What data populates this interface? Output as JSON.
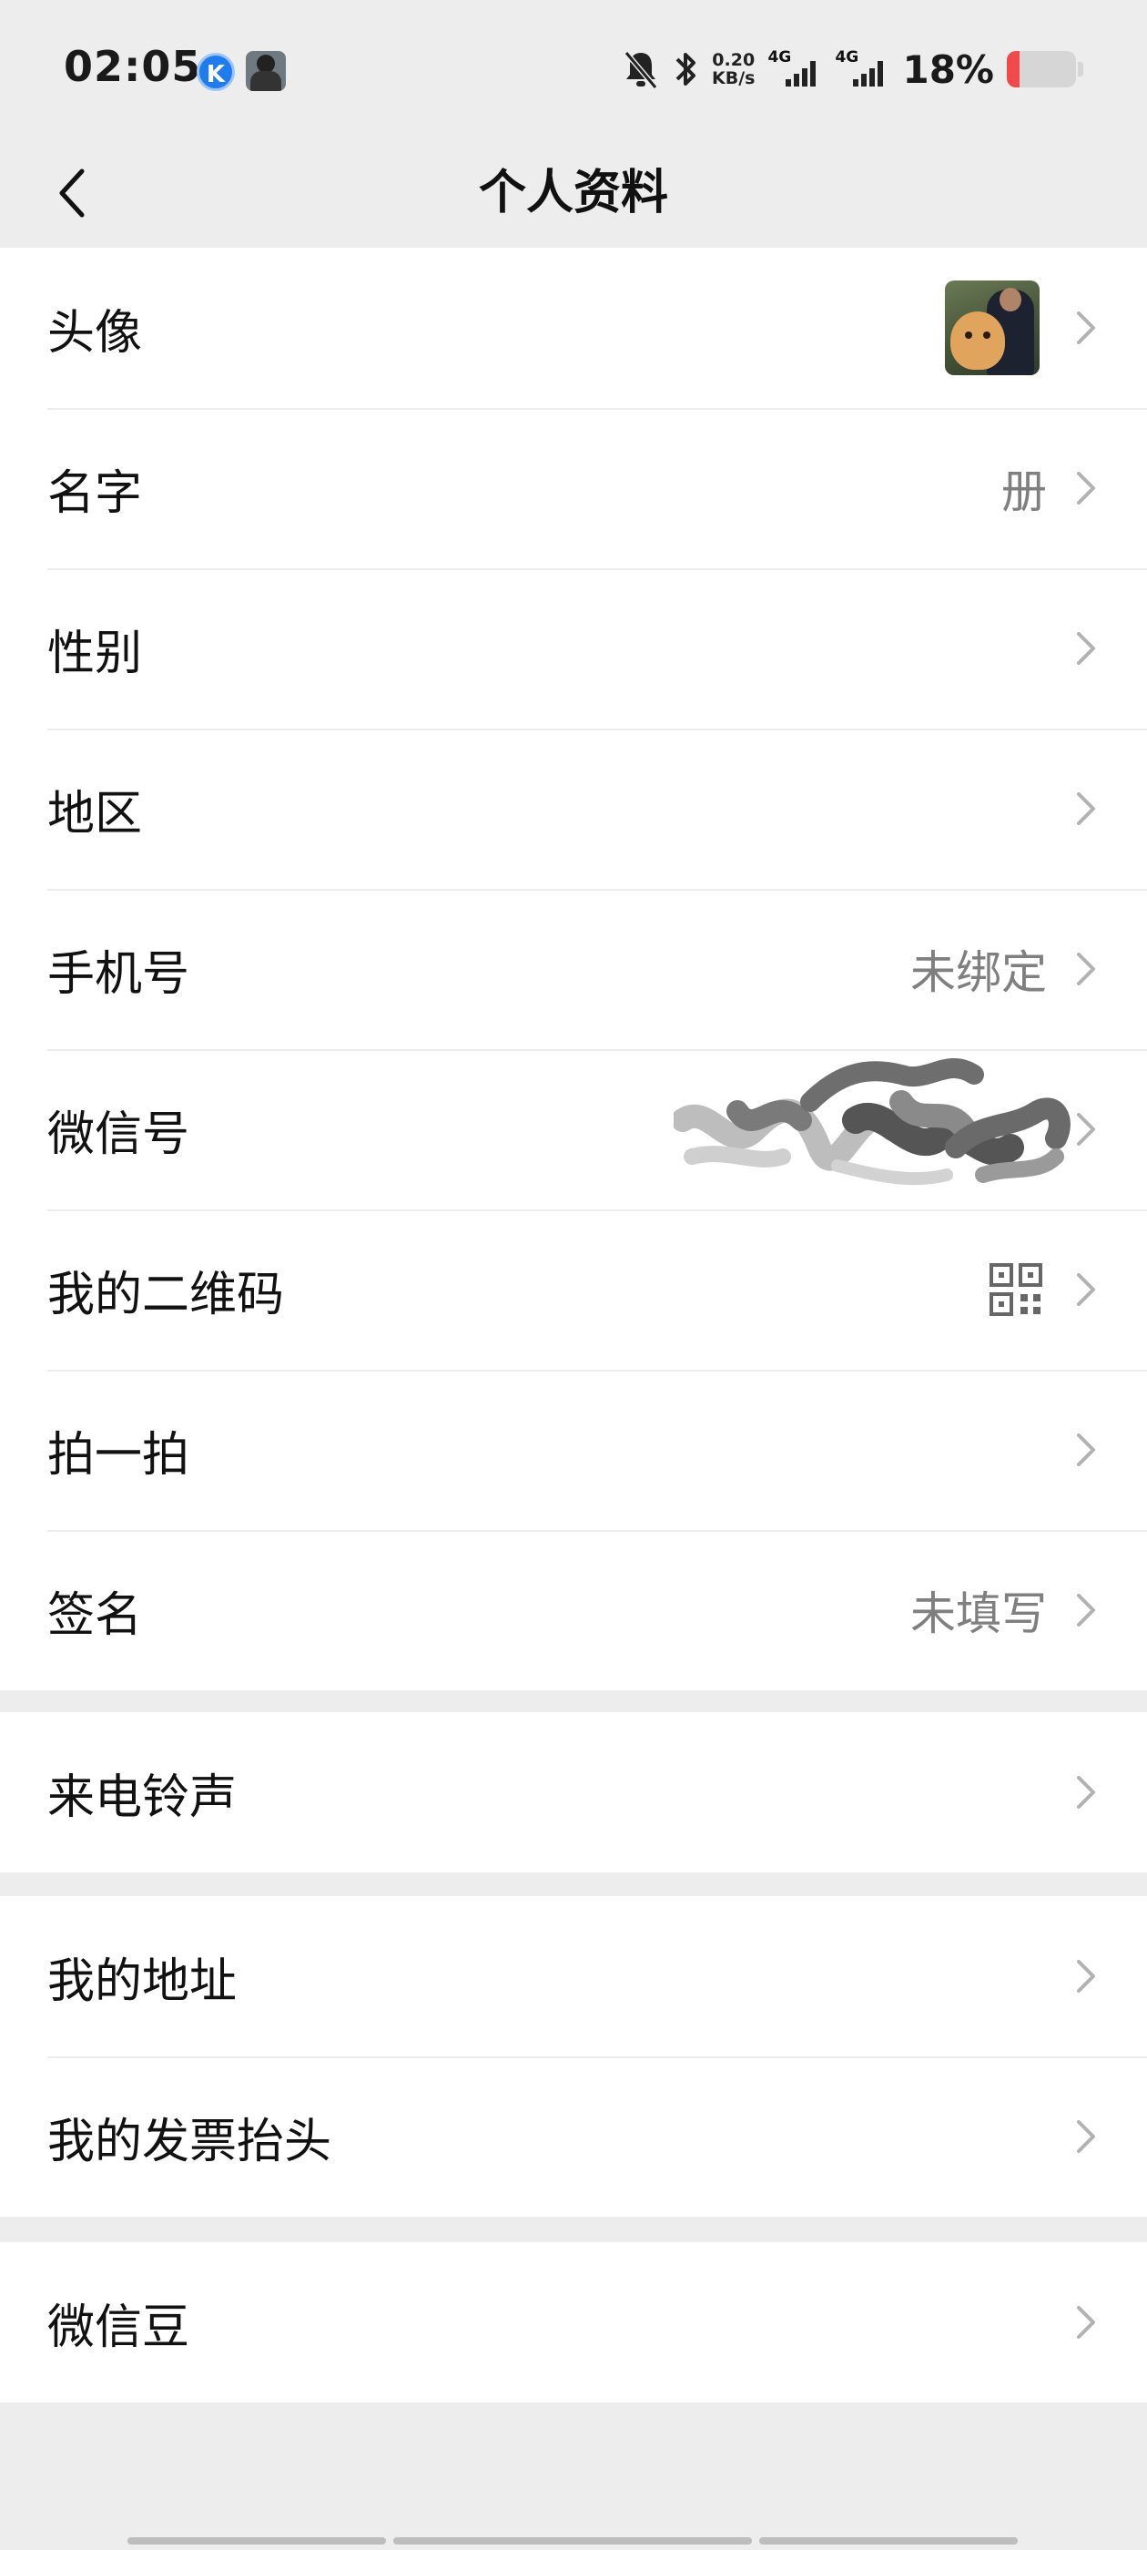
{
  "status_bar": {
    "time": "02:05",
    "k_icon_letter": "K",
    "net_speed_value": "0.20",
    "net_speed_unit": "KB/s",
    "sim1_label": "4G",
    "sim2_label": "4G",
    "battery_percent": "18%",
    "battery_level": 0.18,
    "battery_color": "#f04a4a"
  },
  "nav": {
    "title": "个人资料",
    "back_icon": "chevron-left-icon"
  },
  "rows": {
    "avatar": {
      "label": "头像"
    },
    "name": {
      "label": "名字",
      "value": "册"
    },
    "gender": {
      "label": "性别"
    },
    "region": {
      "label": "地区"
    },
    "phone": {
      "label": "手机号",
      "value": "未绑定"
    },
    "wechat_id": {
      "label": "微信号"
    },
    "qr_code": {
      "label": "我的二维码",
      "icon": "qr-code-icon"
    },
    "pat": {
      "label": "拍一拍"
    },
    "signature": {
      "label": "签名",
      "value": "未填写"
    },
    "ringtone": {
      "label": "来电铃声"
    },
    "address": {
      "label": "我的地址"
    },
    "invoice": {
      "label": "我的发票抬头"
    },
    "beans": {
      "label": "微信豆"
    }
  },
  "colors": {
    "page_bg": "#ededed",
    "row_bg": "#ffffff",
    "value_text": "#7f7f7f",
    "chevron": "#b2b2b2"
  }
}
